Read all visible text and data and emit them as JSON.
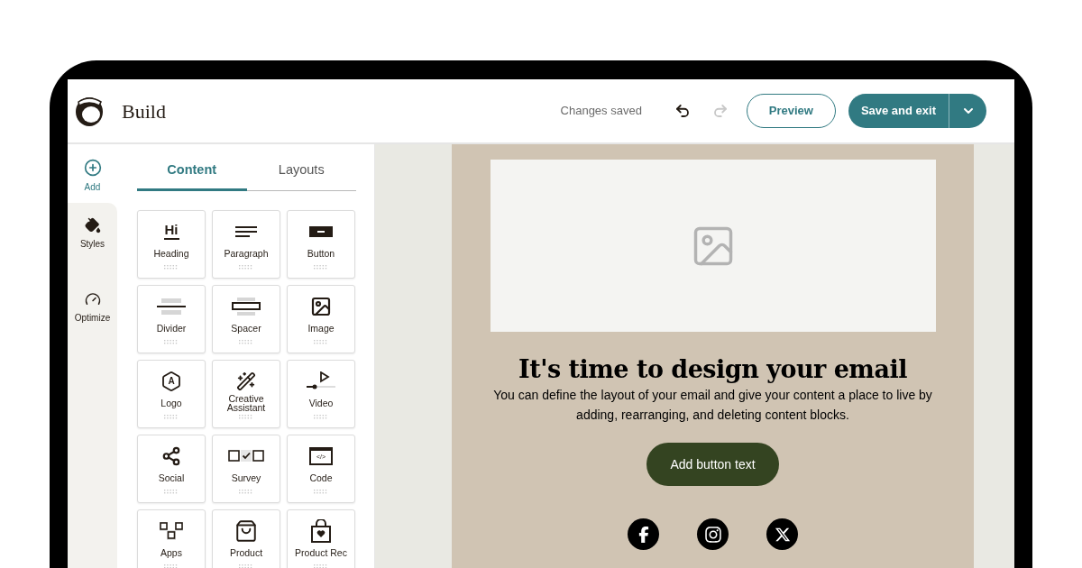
{
  "header": {
    "title": "Build",
    "status": "Changes saved",
    "preview_button": "Preview",
    "save_button": "Save and exit"
  },
  "rail": [
    {
      "kind": "add",
      "label": "Add",
      "selected": true
    },
    {
      "kind": "styles",
      "label": "Styles",
      "selected": false
    },
    {
      "kind": "optimize",
      "label": "Optimize",
      "selected": false
    }
  ],
  "tabs": [
    {
      "label": "Content",
      "selected": true
    },
    {
      "label": "Layouts",
      "selected": false
    }
  ],
  "blocks": [
    {
      "kind": "heading",
      "label": "Heading",
      "icon_text": "Hi"
    },
    {
      "kind": "paragraph",
      "label": "Paragraph"
    },
    {
      "kind": "button",
      "label": "Button"
    },
    {
      "kind": "divider",
      "label": "Divider"
    },
    {
      "kind": "spacer",
      "label": "Spacer"
    },
    {
      "kind": "image",
      "label": "Image"
    },
    {
      "kind": "logo",
      "label": "Logo",
      "icon_text": "A"
    },
    {
      "kind": "creative",
      "label": "Creative Assistant"
    },
    {
      "kind": "video",
      "label": "Video"
    },
    {
      "kind": "social",
      "label": "Social"
    },
    {
      "kind": "survey",
      "label": "Survey"
    },
    {
      "kind": "code",
      "label": "Code",
      "icon_text": "</>"
    },
    {
      "kind": "apps",
      "label": "Apps"
    },
    {
      "kind": "product",
      "label": "Product"
    },
    {
      "kind": "productrec",
      "label": "Product Rec"
    }
  ],
  "email": {
    "heading": "It's time to design your email",
    "body": "You can define the layout of your email and give your content a place to live by adding, rearranging, and deleting content blocks.",
    "button": "Add button text",
    "social": [
      {
        "kind": "facebook"
      },
      {
        "kind": "instagram"
      },
      {
        "kind": "x"
      }
    ]
  }
}
